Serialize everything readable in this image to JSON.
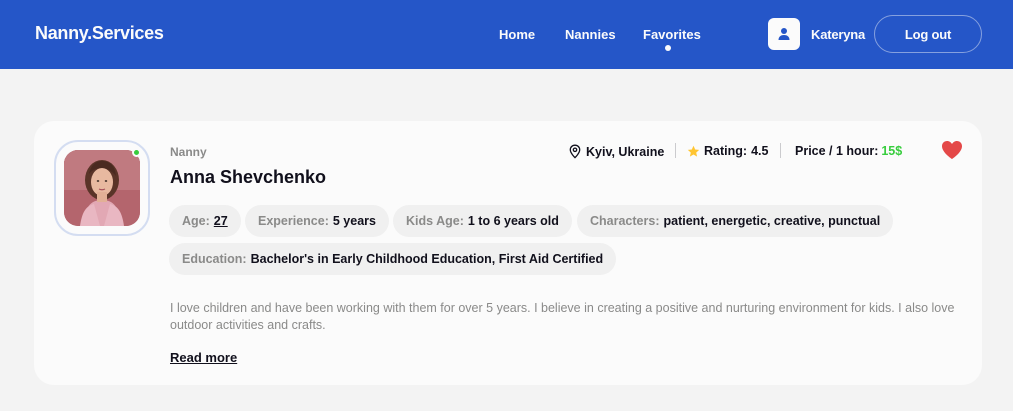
{
  "header": {
    "logo": "Nanny.Services",
    "nav": [
      {
        "label": "Home"
      },
      {
        "label": "Nannies"
      },
      {
        "label": "Favorites"
      }
    ],
    "user_name": "Kateryna",
    "logout_label": "Log out",
    "bg_color": "#2556c8"
  },
  "nanny": {
    "role": "Nanny",
    "name": "Anna Shevchenko",
    "location": "Kyiv, Ukraine",
    "rating_label": "Rating:",
    "rating_value": "4.5",
    "price_label": "Price / 1 hour:",
    "price_value": "15$",
    "online": true,
    "favorite": true,
    "details": {
      "age_label": "Age:",
      "age_value": "27",
      "experience_label": "Experience:",
      "experience_value": "5 years",
      "kids_age_label": "Kids Age:",
      "kids_age_value": "1 to 6 years old",
      "characters_label": "Characters:",
      "characters_value": "patient, energetic, creative, punctual",
      "education_label": "Education:",
      "education_value": "Bachelor's in Early Childhood Education, First Aid Certified"
    },
    "description": "I love children and have been working with them for over 5 years. I believe in creating a positive and nurturing environment for kids. I also love outdoor activities and crafts.",
    "read_more": "Read more"
  },
  "colors": {
    "accent": "#2556c8",
    "online": "#38cd3e",
    "price": "#38cd3e",
    "heart": "#e44848",
    "star": "#ffc531"
  },
  "icons": [
    "user-icon",
    "map-pin-icon",
    "star-icon",
    "heart-icon"
  ]
}
